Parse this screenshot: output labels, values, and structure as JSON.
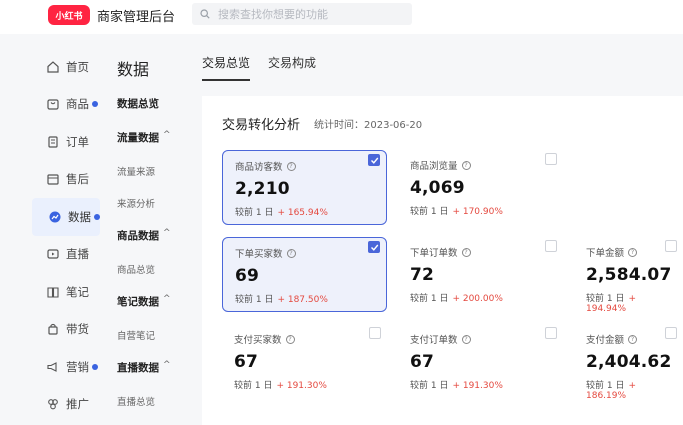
{
  "header": {
    "logo_text": "小红书",
    "app_title": "商家管理后台",
    "search_placeholder": "搜索查找你想要的功能"
  },
  "nav": {
    "items": [
      {
        "label": "首页",
        "icon": "home-icon"
      },
      {
        "label": "商品",
        "icon": "goods-icon",
        "dot": true
      },
      {
        "label": "订单",
        "icon": "order-icon"
      },
      {
        "label": "售后",
        "icon": "after-sales-icon"
      },
      {
        "label": "数据",
        "icon": "data-icon",
        "dot": true,
        "active": true
      },
      {
        "label": "直播",
        "icon": "live-icon"
      },
      {
        "label": "笔记",
        "icon": "note-icon"
      },
      {
        "label": "带货",
        "icon": "bag-icon"
      },
      {
        "label": "营销",
        "icon": "marketing-icon",
        "dot": true
      },
      {
        "label": "推广",
        "icon": "promo-icon"
      }
    ]
  },
  "subnav": {
    "title": "数据",
    "overview": "数据总览",
    "traffic_head": "流量数据",
    "traffic_source": "流量来源",
    "source_analysis": "来源分析",
    "goods_head": "商品数据",
    "goods_overview": "商品总览",
    "notes_head": "笔记数据",
    "own_notes": "自营笔记",
    "live_head": "直播数据",
    "live_overview": "直播总览"
  },
  "tabs": [
    "交易总览",
    "交易构成"
  ],
  "panel": {
    "title": "交易转化分析",
    "date_label": "统计时间：2023-06-20"
  },
  "cards": [
    {
      "label": "商品访客数",
      "value": "2,210",
      "cmp": "较前 1 日",
      "change": "+ 165.94%",
      "checked": true
    },
    {
      "label": "商品浏览量",
      "value": "4,069",
      "cmp": "较前 1 日",
      "change": "+ 170.90%",
      "checked": false
    },
    {
      "label": "下单买家数",
      "value": "69",
      "cmp": "较前 1 日",
      "change": "+ 187.50%",
      "checked": true
    },
    {
      "label": "下单订单数",
      "value": "72",
      "cmp": "较前 1 日",
      "change": "+ 200.00%",
      "checked": false
    },
    {
      "label": "下单金额",
      "value": "2,584.07",
      "cmp": "较前 1 日",
      "change": "+ 194.94%",
      "checked": false
    },
    {
      "label": "支付买家数",
      "value": "67",
      "cmp": "较前 1 日",
      "change": "+ 191.30%",
      "checked": false
    },
    {
      "label": "支付订单数",
      "value": "67",
      "cmp": "较前 1 日",
      "change": "+ 191.30%",
      "checked": false
    },
    {
      "label": "支付金额",
      "value": "2,404.62",
      "cmp": "较前 1 日",
      "change": "+ 186.19%",
      "checked": false
    }
  ],
  "colors": {
    "brand": "#ff2442",
    "accent": "#4a66d9",
    "up": "#e4493f"
  }
}
